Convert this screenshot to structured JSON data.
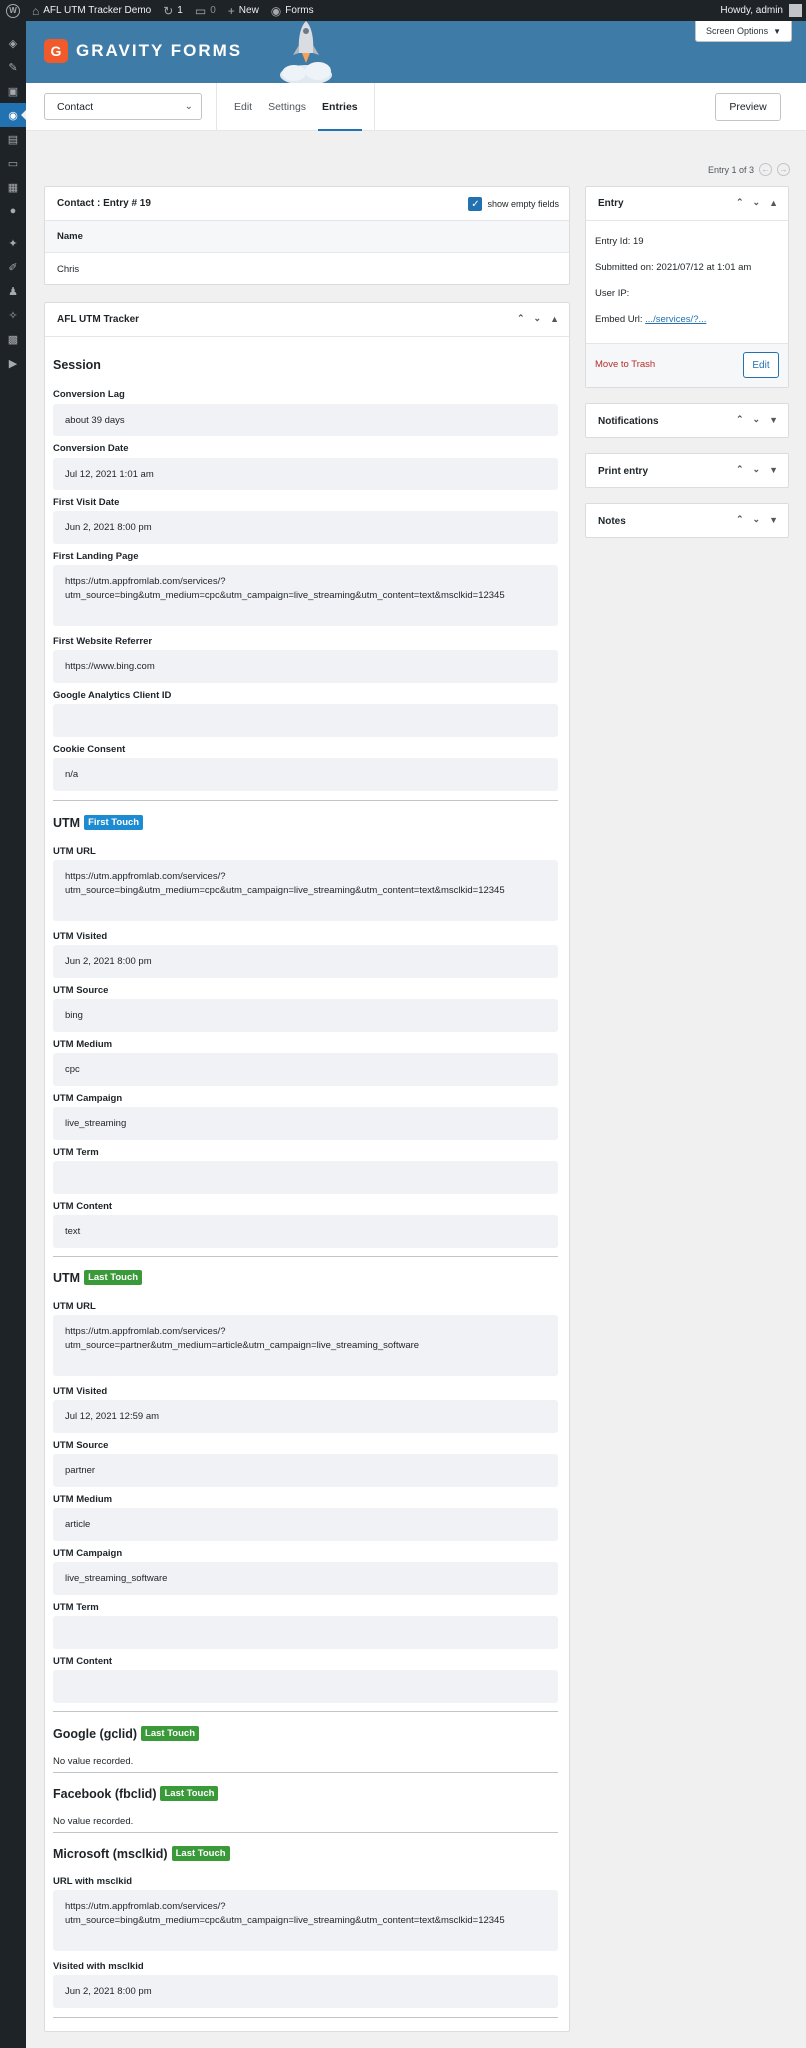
{
  "adminbar": {
    "site_name": "AFL UTM Tracker Demo",
    "updates_count": "1",
    "comments_count": "0",
    "new_label": "New",
    "forms_label": "Forms",
    "greeting": "Howdy, admin"
  },
  "sidebar": {
    "icons": [
      "dashboard-icon",
      "posts-icon",
      "media-icon",
      "forms-icon",
      "pages-icon",
      "comments-icon",
      "appearance-icon",
      "profile-icon",
      "plugins-icon",
      "tools-icon",
      "users-icon",
      "settings-icon",
      "plugin-icon",
      "collapse-icon"
    ]
  },
  "header": {
    "logo_text": "GRAVITY FORMS",
    "logo_mark": "G",
    "screen_options": "Screen Options"
  },
  "toolbar": {
    "form_select": "Contact",
    "tabs": [
      "Edit",
      "Settings",
      "Entries"
    ],
    "active_tab": "Entries",
    "preview": "Preview"
  },
  "pager": {
    "text": "Entry 1 of 3"
  },
  "contact_box": {
    "title": "Contact : Entry # 19",
    "show_empty": "show empty fields",
    "name_label": "Name",
    "name_value": "Chris"
  },
  "tracker": {
    "title": "AFL UTM Tracker",
    "session": {
      "title": "Session",
      "conversion_lag_label": "Conversion Lag",
      "conversion_lag": "about 39 days",
      "conversion_date_label": "Conversion Date",
      "conversion_date": "Jul 12, 2021 1:01 am",
      "first_visit_label": "First Visit Date",
      "first_visit": "Jun 2, 2021 8:00 pm",
      "landing_label": "First Landing Page",
      "landing_1": "https://utm.appfromlab.com/services/?",
      "landing_2": "utm_source=bing&utm_medium=cpc&utm_campaign=live_streaming&utm_content=text&msclkid=12345",
      "referrer_label": "First Website Referrer",
      "referrer": "https://www.bing.com",
      "ga_label": "Google Analytics Client ID",
      "ga": "",
      "cookie_label": "Cookie Consent",
      "cookie": "n/a"
    },
    "first_touch": {
      "title": "UTM",
      "badge": "First Touch",
      "url_label": "UTM URL",
      "url_1": "https://utm.appfromlab.com/services/?",
      "url_2": "utm_source=bing&utm_medium=cpc&utm_campaign=live_streaming&utm_content=text&msclkid=12345",
      "visited_label": "UTM Visited",
      "visited": "Jun 2, 2021 8:00 pm",
      "source_label": "UTM Source",
      "source": "bing",
      "medium_label": "UTM Medium",
      "medium": "cpc",
      "campaign_label": "UTM Campaign",
      "campaign": "live_streaming",
      "term_label": "UTM Term",
      "term": "",
      "content_label": "UTM Content",
      "content": "text"
    },
    "last_touch": {
      "title": "UTM",
      "badge": "Last Touch",
      "url_label": "UTM URL",
      "url_1": "https://utm.appfromlab.com/services/?",
      "url_2": "utm_source=partner&utm_medium=article&utm_campaign=live_streaming_software",
      "visited_label": "UTM Visited",
      "visited": "Jul 12, 2021 12:59 am",
      "source_label": "UTM Source",
      "source": "partner",
      "medium_label": "UTM Medium",
      "medium": "article",
      "campaign_label": "UTM Campaign",
      "campaign": "live_streaming_software",
      "term_label": "UTM Term",
      "term": "",
      "content_label": "UTM Content",
      "content": ""
    },
    "google": {
      "title": "Google (gclid)",
      "badge": "Last Touch",
      "note": "No value recorded."
    },
    "facebook": {
      "title": "Facebook (fbclid)",
      "badge": "Last Touch",
      "note": "No value recorded."
    },
    "microsoft": {
      "title": "Microsoft (msclkid)",
      "badge": "Last Touch",
      "url_label": "URL with msclkid",
      "url_1": "https://utm.appfromlab.com/services/?",
      "url_2": "utm_source=bing&utm_medium=cpc&utm_campaign=live_streaming&utm_content=text&msclkid=12345",
      "visited_label": "Visited with msclkid",
      "visited": "Jun 2, 2021 8:00 pm"
    }
  },
  "entry_box": {
    "title": "Entry",
    "entry_id": "Entry Id: 19",
    "submitted": "Submitted on: 2021/07/12 at 1:01 am",
    "user_ip": "User IP:",
    "embed_label": "Embed Url:",
    "embed_link": ".../services/?...",
    "trash": "Move to Trash",
    "edit": "Edit"
  },
  "notifications_box": {
    "title": "Notifications"
  },
  "print_box": {
    "title": "Print entry"
  },
  "notes_box": {
    "title": "Notes"
  },
  "colors": {
    "accent": "#2271b1",
    "header_bg": "#3e7ba6",
    "first_touch": "#1d8bd1",
    "last_touch": "#3a9a3a",
    "trash": "#b32d2e"
  }
}
